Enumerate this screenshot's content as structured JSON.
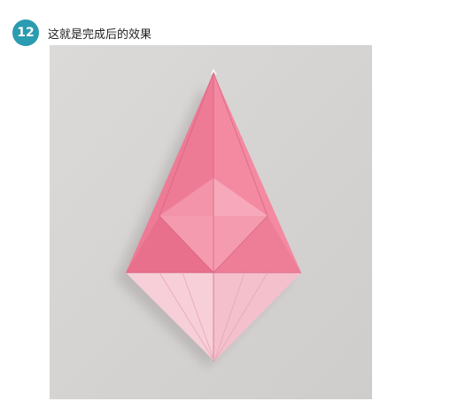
{
  "step": {
    "number": "12",
    "caption": "这就是完成后的效果"
  },
  "photo": {
    "subject": "folded-paper-icon",
    "colors": {
      "badge": "#2a9bb0",
      "paper_pink": "#f07d98",
      "paper_light": "#f6c9d2",
      "background": "#d6d4d3"
    }
  }
}
